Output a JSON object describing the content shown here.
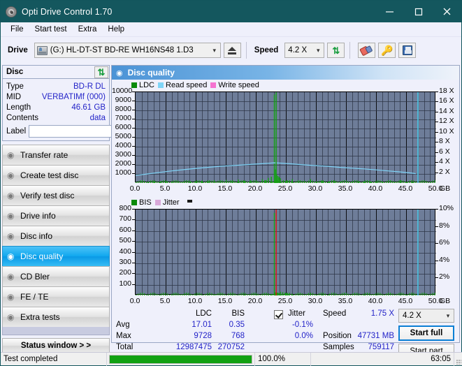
{
  "window": {
    "title": "Opti Drive Control 1.70",
    "icon": "disc-icon",
    "minimize": "minimize-icon",
    "maximize": "maximize-icon",
    "close": "close-icon"
  },
  "menu": [
    "File",
    "Start test",
    "Extra",
    "Help"
  ],
  "toolbar": {
    "drive_label": "Drive",
    "drive_value": "(G:)   HL-DT-ST BD-RE  WH16NS48 1.D3",
    "eject_icon": "eject-icon",
    "speed_label": "Speed",
    "speed_value": "4.2 X",
    "refresh_icon": "refresh-icon",
    "erase_icon": "eraser-icon",
    "tools_icon": "gold-tools-icon",
    "save_icon": "save-icon"
  },
  "disc_panel": {
    "title": "Disc",
    "refresh_icon": "refresh-icon",
    "rows": [
      {
        "label": "Type",
        "value": "BD-R DL"
      },
      {
        "label": "MID",
        "value": "VERBATIMf (000)"
      },
      {
        "label": "Length",
        "value": "46.61 GB"
      },
      {
        "label": "Contents",
        "value": "data"
      }
    ],
    "label_field_label": "Label",
    "label_field_value": "",
    "label_icon": "cd-icon"
  },
  "nav": {
    "items": [
      {
        "label": "Transfer rate",
        "icon": "disc-transfer-icon",
        "active": false
      },
      {
        "label": "Create test disc",
        "icon": "disc-create-icon",
        "active": false
      },
      {
        "label": "Verify test disc",
        "icon": "disc-verify-icon",
        "active": false
      },
      {
        "label": "Drive info",
        "icon": "disc-drive-icon",
        "active": false
      },
      {
        "label": "Disc info",
        "icon": "disc-info-icon",
        "active": false
      },
      {
        "label": "Disc quality",
        "icon": "disc-quality-icon",
        "active": true
      },
      {
        "label": "CD Bler",
        "icon": "disc-bler-icon",
        "active": false
      },
      {
        "label": "FE / TE",
        "icon": "disc-fete-icon",
        "active": false
      },
      {
        "label": "Extra tests",
        "icon": "disc-extra-icon",
        "active": false
      }
    ],
    "status_window": "Status window > >"
  },
  "panel": {
    "header": "Disc quality",
    "header_icon": "disc-quality-icon"
  },
  "stats": {
    "col_ldc": "LDC",
    "col_bis": "BIS",
    "row_avg": "Avg",
    "row_max": "Max",
    "row_total": "Total",
    "ldc_avg": "17.01",
    "ldc_max": "9728",
    "ldc_total": "12987475",
    "bis_avg": "0.35",
    "bis_max": "768",
    "bis_total": "270752",
    "jitter_label": "Jitter",
    "jitter_checked": true,
    "jitter_avg": "-0.1%",
    "jitter_max": "0.0%",
    "speed_label": "Speed",
    "speed_value": "1.75 X",
    "position_label": "Position",
    "position_value": "47731 MB",
    "samples_label": "Samples",
    "samples_value": "759117",
    "speed_select": "4.2 X",
    "start_full": "Start full",
    "start_part": "Start part"
  },
  "statusbar": {
    "text": "Test completed",
    "percent": "100.0%",
    "progress": 100,
    "elapsed": "63:05"
  },
  "colors": {
    "titlebar": "#14575e",
    "plot_bg": "#6e7d99",
    "ldc": "#13a013",
    "bis": "#13a013",
    "read_speed": "#7fd4f7",
    "write_speed": "#f573d0",
    "jitter": "#d9a8d9",
    "marker_red": "#e01010",
    "marker_cyan": "#49d6f7",
    "accent": "#0b7fd4",
    "value_text": "#2323c8",
    "progress_fill": "#12a112"
  },
  "chart_data": [
    {
      "type": "area",
      "name": "LDC chart",
      "title": "",
      "xlabel": "GB",
      "ylabel": "",
      "xlim": [
        0,
        50
      ],
      "ylim": [
        0,
        10000
      ],
      "grid": true,
      "legend_position": "top-left",
      "legend": [
        "LDC",
        "Read speed",
        "Write speed"
      ],
      "yticks": [
        1000,
        2000,
        3000,
        4000,
        5000,
        6000,
        7000,
        8000,
        9000,
        10000
      ],
      "ytick_labels": [
        "1000",
        "2000",
        "3000",
        "4000",
        "5000",
        "6000",
        "7000",
        "8000",
        "9000",
        "10000"
      ],
      "y2ticks": [
        2,
        4,
        6,
        8,
        10,
        12,
        14,
        16,
        18
      ],
      "y2tick_labels": [
        "2 X",
        "4 X",
        "6 X",
        "8 X",
        "10 X",
        "12 X",
        "14 X",
        "16 X",
        "18 X"
      ],
      "y2lim": [
        0,
        18
      ],
      "xticks": [
        0,
        5,
        10,
        15,
        20,
        25,
        30,
        35,
        40,
        45,
        50
      ],
      "xtick_labels": [
        "0.0",
        "5.0",
        "10.0",
        "15.0",
        "20.0",
        "25.0",
        "30.0",
        "35.0",
        "40.0",
        "45.0",
        "50.0"
      ],
      "xunit": "GB",
      "series": [
        {
          "name": "LDC",
          "color": "#13a013",
          "kind": "area",
          "x": [
            0,
            1,
            2,
            3,
            4,
            5,
            6,
            7,
            8,
            9,
            10,
            11,
            12,
            13,
            14,
            15,
            16,
            17,
            18,
            19,
            20,
            21,
            21.5,
            22,
            22.5,
            23,
            23.2,
            23.4,
            23.6,
            23.8,
            24,
            24.5,
            25,
            25.5,
            26,
            27,
            28,
            29,
            30,
            31,
            32,
            33,
            34,
            35,
            36,
            37,
            38,
            39,
            40,
            41,
            42,
            43,
            44,
            45,
            46,
            46.6
          ],
          "y": [
            120,
            130,
            125,
            160,
            140,
            180,
            135,
            190,
            150,
            200,
            170,
            260,
            180,
            300,
            190,
            340,
            200,
            380,
            230,
            300,
            260,
            420,
            300,
            560,
            700,
            9728,
            1500,
            900,
            780,
            640,
            520,
            300,
            250,
            220,
            430,
            200,
            250,
            420,
            200,
            230,
            180,
            200,
            170,
            190,
            160,
            180,
            150,
            170,
            140,
            160,
            130,
            150,
            280,
            120,
            100
          ]
        },
        {
          "name": "Read speed",
          "color": "#7fd4f7",
          "kind": "line",
          "x": [
            0,
            2,
            4,
            6,
            8,
            10,
            12,
            14,
            16,
            18,
            20,
            22,
            23,
            24,
            26,
            28,
            30,
            32,
            34,
            36,
            38,
            40,
            42,
            44,
            46,
            46.6
          ],
          "y": [
            1.5,
            1.8,
            2.1,
            2.4,
            2.65,
            2.9,
            3.1,
            3.3,
            3.45,
            3.6,
            3.75,
            3.9,
            4.0,
            3.95,
            3.8,
            3.6,
            3.45,
            3.3,
            3.1,
            2.95,
            2.8,
            2.6,
            2.4,
            2.2,
            1.95,
            1.85
          ],
          "axis": "right"
        },
        {
          "name": "Write speed",
          "color": "#f573d0",
          "kind": "line",
          "x": [],
          "y": [],
          "axis": "right"
        }
      ],
      "markers": [
        {
          "name": "ldc-spike-marker",
          "x": 23.3,
          "color": "#13a013"
        },
        {
          "name": "end-of-data-marker",
          "x": 46.9,
          "color": "#49d6f7"
        }
      ]
    },
    {
      "type": "area",
      "name": "BIS chart",
      "title": "",
      "xlabel": "GB",
      "ylabel": "",
      "xlim": [
        0,
        50
      ],
      "ylim": [
        0,
        800
      ],
      "grid": true,
      "legend_position": "top-left",
      "legend": [
        "BIS",
        "Jitter"
      ],
      "yticks": [
        100,
        200,
        300,
        400,
        500,
        600,
        700,
        800
      ],
      "ytick_labels": [
        "100",
        "200",
        "300",
        "400",
        "500",
        "600",
        "700",
        "800"
      ],
      "y2ticks": [
        2,
        4,
        6,
        8,
        10
      ],
      "y2tick_labels": [
        "2%",
        "4%",
        "6%",
        "8%",
        "10%"
      ],
      "y2lim": [
        0,
        10
      ],
      "xticks": [
        0,
        5,
        10,
        15,
        20,
        25,
        30,
        35,
        40,
        45,
        50
      ],
      "xtick_labels": [
        "0.0",
        "5.0",
        "10.0",
        "15.0",
        "20.0",
        "25.0",
        "30.0",
        "35.0",
        "40.0",
        "45.0",
        "50.0"
      ],
      "xunit": "GB",
      "series": [
        {
          "name": "BIS",
          "color": "#13a013",
          "kind": "area",
          "x": [
            0,
            2,
            4,
            6,
            8,
            10,
            12,
            13,
            14,
            16,
            18,
            20,
            21,
            22,
            22.5,
            23,
            23.2,
            23.4,
            23.6,
            24,
            24.4,
            24.8,
            25,
            25.4,
            26,
            27,
            28,
            29,
            30,
            31,
            32,
            34,
            36,
            38,
            40,
            42,
            44,
            45,
            46,
            46.6
          ],
          "y": [
            3,
            3,
            4,
            3,
            4,
            3,
            5,
            10,
            4,
            4,
            6,
            8,
            6,
            10,
            14,
            768,
            30,
            22,
            26,
            34,
            30,
            26,
            20,
            14,
            10,
            6,
            8,
            12,
            8,
            6,
            5,
            4,
            4,
            4,
            4,
            4,
            4,
            5,
            4,
            3
          ]
        },
        {
          "name": "Jitter",
          "color": "#d9a8d9",
          "kind": "line",
          "x": [],
          "y": [],
          "axis": "right"
        }
      ],
      "markers": [
        {
          "name": "bis-spike-marker",
          "x": 23.3,
          "color": "#e01010"
        },
        {
          "name": "end-of-data-marker",
          "x": 46.9,
          "color": "#49d6f7"
        }
      ]
    }
  ]
}
